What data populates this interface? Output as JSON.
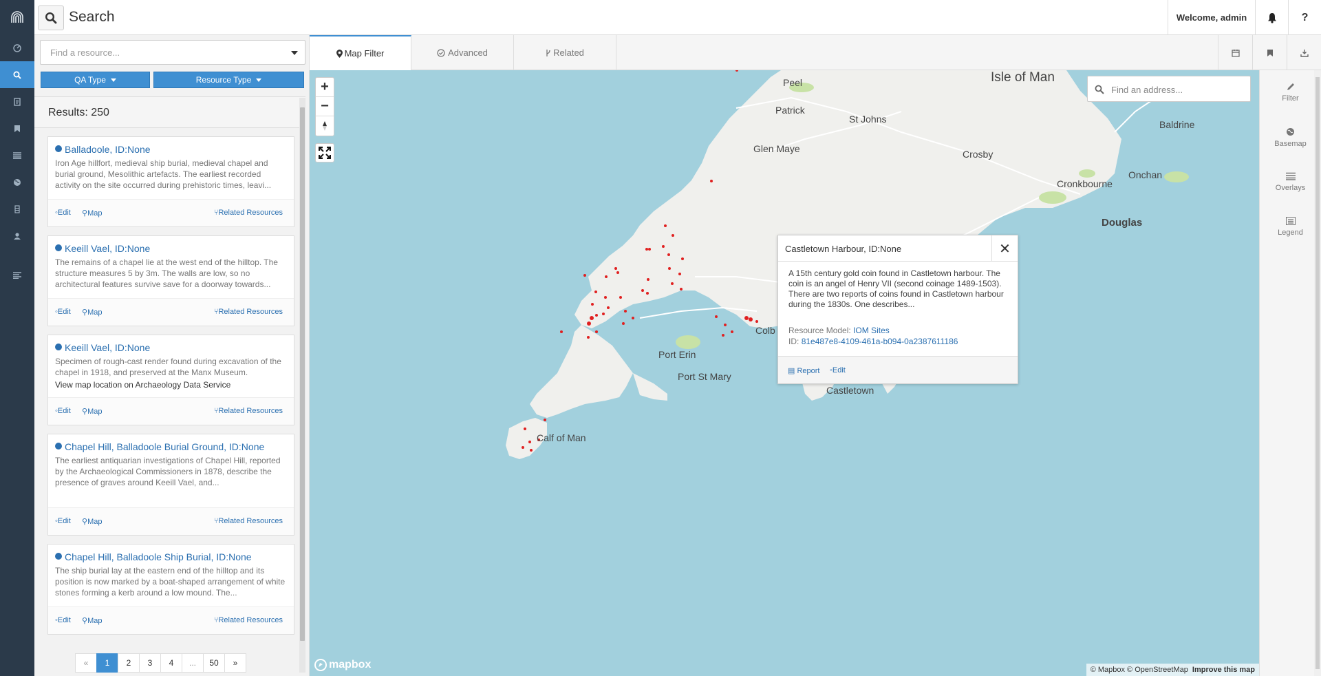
{
  "nav": {
    "items": [
      {
        "name": "dashboard-icon",
        "active": false
      },
      {
        "name": "search-icon",
        "active": true
      },
      {
        "name": "resource-icon",
        "active": false
      },
      {
        "name": "bookmark-icon",
        "active": false
      },
      {
        "name": "list-icon",
        "active": false
      },
      {
        "name": "globe-icon",
        "active": false
      },
      {
        "name": "database-icon",
        "active": false
      },
      {
        "name": "user-icon",
        "active": false
      },
      {
        "name": "menu-icon",
        "active": false
      }
    ]
  },
  "header": {
    "title": "Search",
    "welcome": "Welcome, admin",
    "help": "?"
  },
  "filters": {
    "find_placeholder": "Find a resource...",
    "qa_type": "QA Type",
    "resource_type": "Resource Type"
  },
  "results": {
    "count_label": "Results: 250",
    "items": [
      {
        "title": "Balladoole, ID:None",
        "desc": "Iron Age hillfort, medieval ship burial, medieval chapel and burial ground, Mesolithic artefacts. The earliest recorded activity on the site occurred during prehistoric times, leavi...",
        "edit": "Edit",
        "map": "Map",
        "related": "Related Resources"
      },
      {
        "title": "Keeill Vael, ID:None",
        "desc": "The remains of a chapel lie at the west end of the hilltop. The structure measures 5 by 3m. The walls are low, so no architectural features survive save for a doorway towards...",
        "edit": "Edit",
        "map": "Map",
        "related": "Related Resources"
      },
      {
        "title": "Keeill Vael, ID:None",
        "desc": "Specimen of rough-cast render found during excavation of the chapel in 1918, and preserved at the Manx Museum.",
        "extra": "View map location on Archaeology Data Service",
        "edit": "Edit",
        "map": "Map",
        "related": "Related Resources"
      },
      {
        "title": "Chapel Hill, Balladoole Burial Ground, ID:None",
        "desc": "The earliest antiquarian investigations of Chapel Hill, reported by the Archaeological Commissioners in 1878, describe the presence of graves around Keeill Vael, and...",
        "edit": "Edit",
        "map": "Map",
        "related": "Related Resources"
      },
      {
        "title": "Chapel Hill, Balladoole Ship Burial, ID:None",
        "desc": "The ship burial lay at the eastern end of the hilltop and its position is now marked by a boat-shaped arrangement of white stones forming a kerb around a low mound. The...",
        "edit": "Edit",
        "map": "Map",
        "related": "Related Resources"
      }
    ]
  },
  "pagination": {
    "prev": "«",
    "pages": [
      "1",
      "2",
      "3",
      "4",
      "...",
      "50"
    ],
    "next": "»",
    "current": "1"
  },
  "tabs": {
    "map_filter": "Map Filter",
    "advanced": "Advanced",
    "related": "Related"
  },
  "map": {
    "zoom_in": "+",
    "zoom_out": "−",
    "address_placeholder": "Find an address...",
    "places": {
      "isle_of_man": "Isle of Man",
      "peel": "Peel",
      "patrick": "Patrick",
      "st_johns": "St Johns",
      "glen_maye": "Glen Maye",
      "crosby": "Crosby",
      "baldrine": "Baldrine",
      "cronkbourne": "Cronkbourne",
      "onchan": "Onchan",
      "douglas": "Douglas",
      "colby": "Colb",
      "port_erin": "Port Erin",
      "port_st_mary": "Port St Mary",
      "castletown": "Castletown",
      "calf_of_man": "Calf of Man"
    },
    "attribution": "© Mapbox © OpenStreetMap",
    "improve": "Improve this map",
    "logo": "mapbox"
  },
  "popup": {
    "title": "Castletown Harbour, ID:None",
    "close": "✕",
    "desc": "A 15th century gold coin found in Castletown harbour. The coin is an angel of Henry VII (second coinage 1489-1503). There are two reports of coins found in Castletown harbour during the 1830s. One describes...",
    "model_label": "Resource Model:",
    "model_value": "IOM Sites",
    "id_label": "ID:",
    "id_value": "81e487e8-4109-461a-b094-0a2387611186",
    "report": "Report",
    "edit": "Edit"
  },
  "rightpanel": {
    "filter": "Filter",
    "basemap": "Basemap",
    "overlays": "Overlays",
    "legend": "Legend"
  },
  "colors": {
    "accent": "#3f8fd2",
    "nav_bg": "#2b3a4a",
    "water": "#a2d0dd",
    "land": "#f0f0ed",
    "park": "#c8e2a6",
    "marker": "#e02020"
  }
}
